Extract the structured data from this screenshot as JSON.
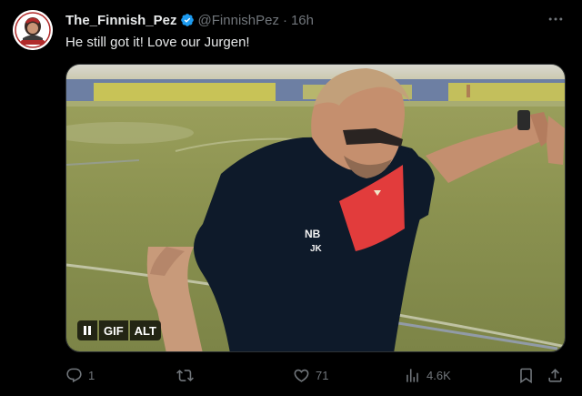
{
  "colors": {
    "background": "#000000",
    "text_primary": "#e7e9ea",
    "text_secondary": "#71767b",
    "verified_blue": "#1d9bf0"
  },
  "author": {
    "display_name": "The_Finnish_Pez",
    "handle": "@FinnishPez",
    "separator": "·",
    "timestamp": "16h",
    "verified": true,
    "avatar_icon": "avatar-logo"
  },
  "tweet": {
    "text": "He still got it! Love our Jurgen!"
  },
  "media": {
    "badges": {
      "pause_icon": "pause-icon",
      "gif_label": "GIF",
      "alt_label": "ALT"
    }
  },
  "actions": {
    "reply": {
      "icon": "reply-icon",
      "count": "1"
    },
    "retweet": {
      "icon": "retweet-icon",
      "count": ""
    },
    "like": {
      "icon": "heart-icon",
      "count": "71"
    },
    "views": {
      "icon": "views-icon",
      "count": "4.6K"
    },
    "bookmark": {
      "icon": "bookmark-icon"
    },
    "share": {
      "icon": "share-icon"
    }
  },
  "menu": {
    "icon": "more-icon"
  }
}
